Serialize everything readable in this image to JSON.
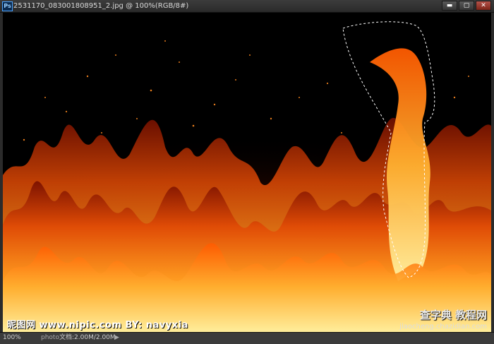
{
  "window": {
    "app_badge": "Ps",
    "title": "2531170_083001808951_2.jpg @ 100%(RGB/8#)",
    "buttons": {
      "minimize": "▬",
      "maximize": "▢",
      "close": "✕"
    }
  },
  "watermarks": {
    "left": "昵图网 www.nipic.com  BY: navyxia",
    "brand": "查字典 教程网",
    "url": "jiaocheng.chazidian.com"
  },
  "statusbar": {
    "zoom": "100%",
    "sub": "photo",
    "doc_info": "文档:2.00M/2.00M",
    "arrow": "▶"
  },
  "colors": {
    "frame": "#2b2b2b",
    "titlebar": "#333333",
    "flame_core": "#ffd36a",
    "flame_mid": "#ff7a12",
    "flame_dark": "#a81c00"
  }
}
